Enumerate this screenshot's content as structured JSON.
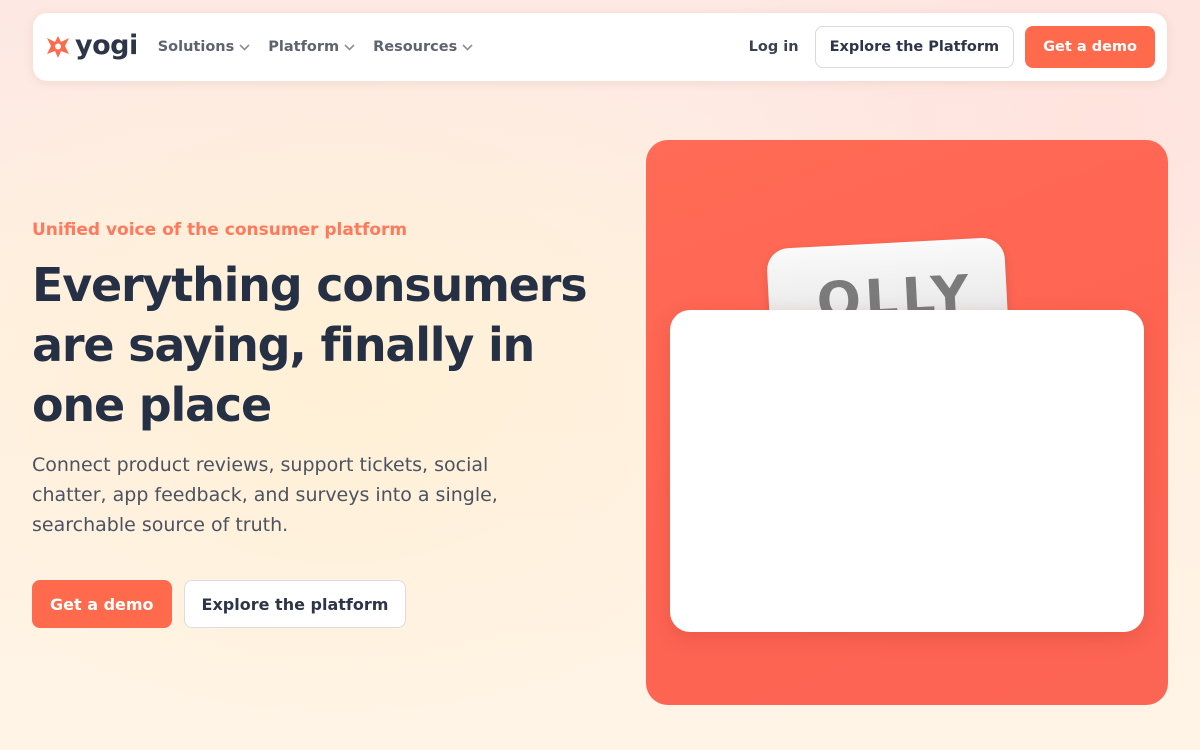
{
  "nav": {
    "logo_text": "yogi",
    "menu": [
      {
        "label": "Solutions"
      },
      {
        "label": "Platform"
      },
      {
        "label": "Resources"
      }
    ],
    "login_label": "Log in",
    "explore_label": "Explore the Platform",
    "demo_label": "Get a demo"
  },
  "hero": {
    "eyebrow": "Unified voice of the consumer platform",
    "headline": "Everything consumers are saying, finally in one place",
    "subtext": "Connect product reviews, support tickets, social chatter, app feedback, and surveys into a single, searchable source of truth.",
    "primary_cta": "Get a demo",
    "secondary_cta": "Explore the platform"
  },
  "visual": {
    "product_text": "OLLY"
  },
  "colors": {
    "accent": "#ff6a4d",
    "eyebrow": "#ff7a5c",
    "heading": "#253045",
    "panel": "#ff6652"
  }
}
